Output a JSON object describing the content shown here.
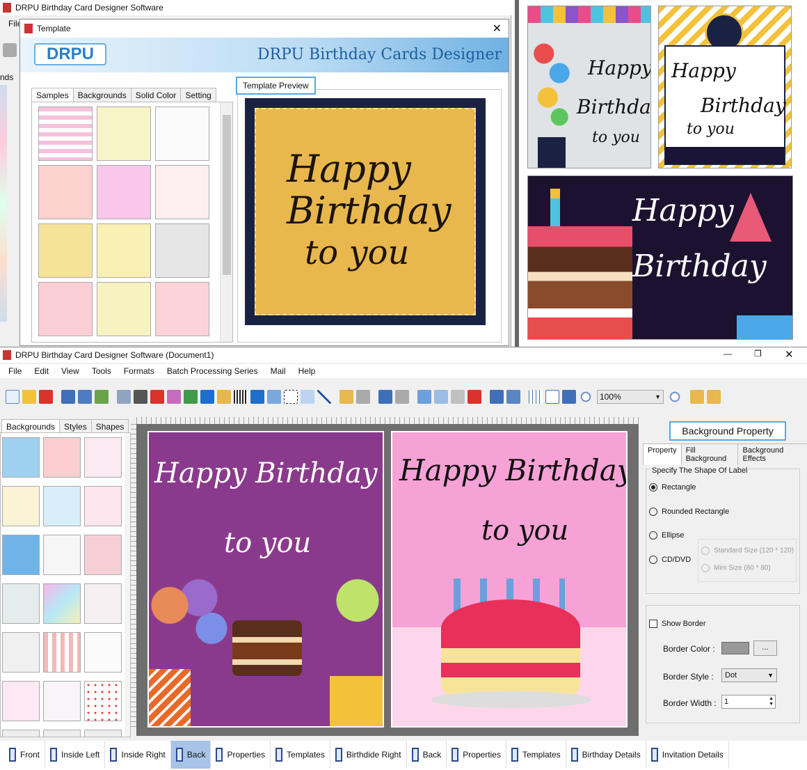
{
  "top_window": {
    "title": "DRPU Birthday Card Designer Software",
    "menu_file": "File",
    "side_label": "nds"
  },
  "template_dialog": {
    "title": "Template",
    "logo": "DRPU",
    "banner": "DRPU Birthday Cards Designer",
    "tabs": [
      "Samples",
      "Backgrounds",
      "Solid Color",
      "Setting"
    ],
    "preview_label": "Template Preview",
    "preview_text": [
      "Happy",
      "Birthday",
      "to you"
    ]
  },
  "showcase": {
    "card1": [
      "Happy",
      "Birthday",
      "to you"
    ],
    "card2": [
      "Happy",
      "Birthday",
      "to you"
    ],
    "card3": [
      "Happy",
      "Birthday"
    ]
  },
  "main_window": {
    "title": "DRPU Birthday Card Designer Software (Document1)",
    "menu": [
      "File",
      "Edit",
      "View",
      "Tools",
      "Formats",
      "Batch Processing Series",
      "Mail",
      "Help"
    ],
    "zoom": "100%",
    "left_tabs": [
      "Backgrounds",
      "Styles",
      "Shapes"
    ],
    "card_left": [
      "Happy Birthday",
      "to you"
    ],
    "card_right": [
      "Happy Birthday",
      "to you"
    ]
  },
  "property_panel": {
    "header": "Background Property",
    "tabs": [
      "Property",
      "Fill Background",
      "Background Effects"
    ],
    "group_title": "Specify The Shape Of Label",
    "shapes": [
      "Rectangle",
      "Rounded Rectangle",
      "Ellipse",
      "CD/DVD"
    ],
    "sizes": [
      "Standard Size (120 * 120)",
      "Mini Size (80 * 80)"
    ],
    "show_border": "Show Border",
    "border_color_label": "Border Color :",
    "browse": "...",
    "border_style_label": "Border Style :",
    "border_style_value": "Dot",
    "border_width_label": "Border Width :",
    "border_width_value": "1"
  },
  "bottom_tabs": [
    "Front",
    "Inside Left",
    "Inside Right",
    "Back",
    "Properties",
    "Templates",
    "Birthdide Right",
    "Back",
    "Properties",
    "Templates",
    "Birthday Details",
    "Invitation Details"
  ],
  "colors": {
    "accent": "#1e6fcc",
    "purple_card": "#8a3a8c",
    "pink_card": "#f7a2d6",
    "gold": "#e8b84e",
    "navy": "#1a2244"
  }
}
